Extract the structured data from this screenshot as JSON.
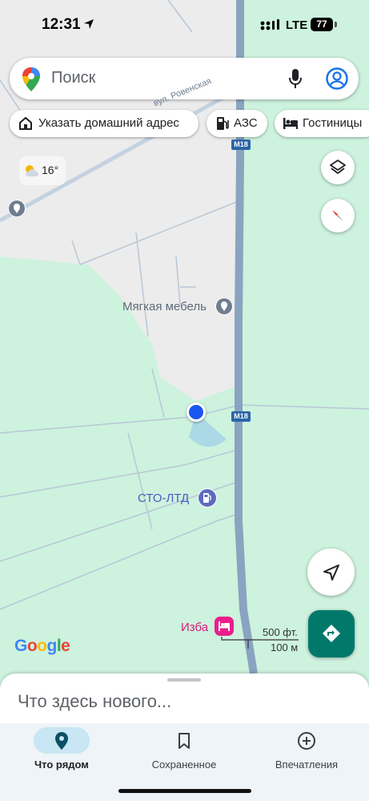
{
  "status_bar": {
    "time": "12:31",
    "network": "LTE",
    "battery": "77"
  },
  "search": {
    "placeholder": "Поиск"
  },
  "chips": [
    {
      "label": "Указать домашний адрес",
      "icon": "home-icon"
    },
    {
      "label": "АЗС",
      "icon": "gas-station-icon"
    },
    {
      "label": "Гостиницы",
      "icon": "hotel-icon"
    }
  ],
  "weather": {
    "temperature": "16°",
    "icon": "partly-cloudy-icon"
  },
  "map": {
    "road_shields": [
      "M18",
      "M18"
    ],
    "street_label": "вул. Ровенская",
    "places": [
      {
        "name": "Мягкая мебель",
        "icon": "place-pin-icon"
      },
      {
        "name": "СТО-ЛТД",
        "icon": "gas-pump-icon"
      },
      {
        "name": "Изба",
        "icon": "hotel-icon"
      }
    ],
    "scale": {
      "imperial": "500 фт.",
      "metric": "100 м"
    },
    "google_logo": "Google"
  },
  "sheet": {
    "title": "Что здесь нового..."
  },
  "bottom_nav": [
    {
      "label": "Что рядом",
      "icon": "explore-pin-icon",
      "active": true
    },
    {
      "label": "Сохраненное",
      "icon": "bookmark-icon",
      "active": false
    },
    {
      "label": "Впечатления",
      "icon": "add-circle-icon",
      "active": false
    }
  ],
  "colors": {
    "land": "#e8eaed",
    "green": "#cdf2de",
    "road": "#8aa3c0",
    "accent": "#00796b",
    "location": "#1a56f0"
  }
}
